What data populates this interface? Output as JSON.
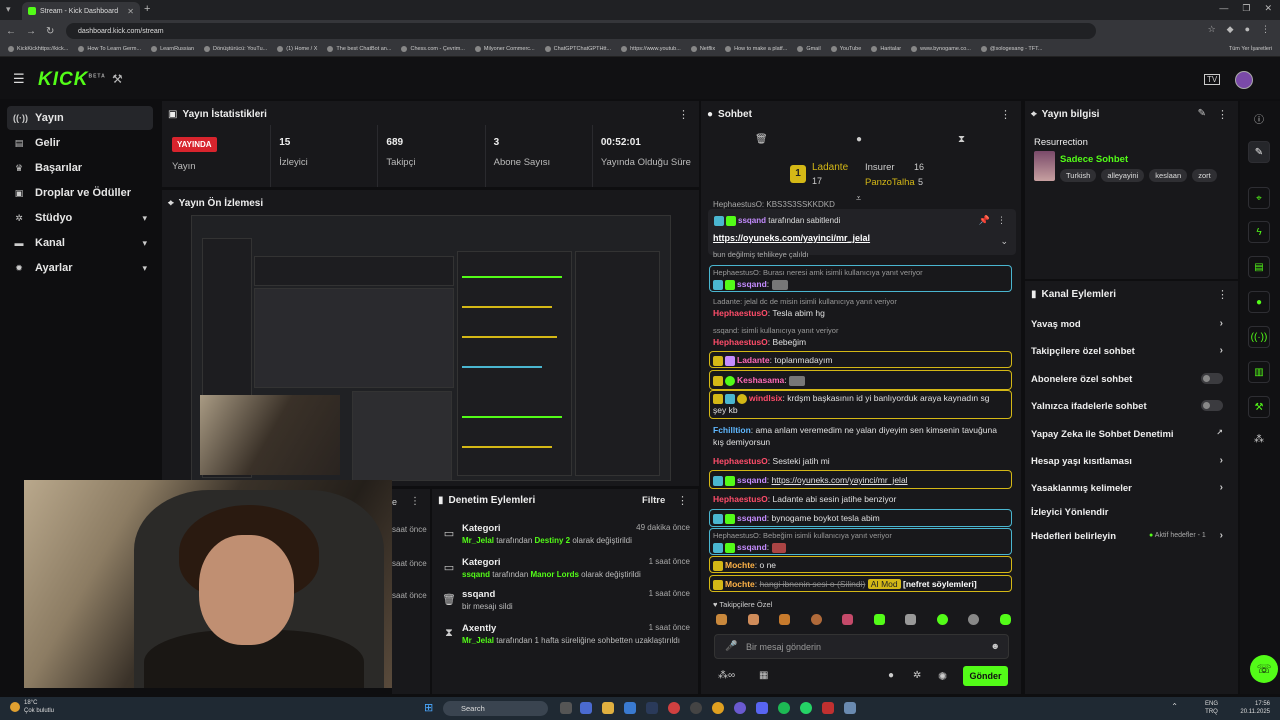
{
  "browser": {
    "tab_title": "Stream - Kick Dashboard",
    "url": "dashboard.kick.com/stream",
    "bookmarks": [
      "KickKickhttps://kick...",
      "How To Learn Germ...",
      "LearnRussian",
      "Dönüştürücü: YouTu...",
      "(1) Home / X",
      "The best ChatBot an...",
      "Chess.com - Çevrim...",
      "Milyoner Commerc...",
      "ChatGPTChatGPTHtt...",
      "https://www.youtub...",
      "Netflix",
      "How to make a platf...",
      "Gmail",
      "YouTube",
      "Haritalar",
      "www.bynogame.co...",
      "@sologesang - TFT..."
    ],
    "all_bookmarks": "Tüm Yer İşaretleri"
  },
  "header": {
    "logo": "KICK",
    "logo_sup": "BETA"
  },
  "sidebar": {
    "items": [
      {
        "label": "Yayın",
        "icon": "broadcast-icon"
      },
      {
        "label": "Gelir",
        "icon": "money-icon"
      },
      {
        "label": "Başarılar",
        "icon": "trophy-icon"
      },
      {
        "label": "Droplar ve Ödüller",
        "icon": "gift-icon"
      },
      {
        "label": "Stüdyo",
        "icon": "gear-icon"
      },
      {
        "label": "Kanal",
        "icon": "channel-icon"
      },
      {
        "label": "Ayarlar",
        "icon": "settings-icon"
      }
    ]
  },
  "stats": {
    "title": "Yayın İstatistikleri",
    "live_badge": "YAYINDA",
    "cells": [
      {
        "value": "",
        "label": "Yayın"
      },
      {
        "value": "15",
        "label": "İzleyici"
      },
      {
        "value": "689",
        "label": "Takipçi"
      },
      {
        "value": "3",
        "label": "Abone Sayısı"
      },
      {
        "value": "00:52:01",
        "label": "Yayında Olduğu Süre"
      }
    ]
  },
  "preview": {
    "title": "Yayın Ön İzlemesi"
  },
  "mod_actions": {
    "title": "Denetim Eylemleri",
    "filter": "Filtre",
    "left_times": [
      "saat önce",
      "saat önce",
      "saat önce"
    ],
    "items": [
      {
        "title": "Kategori",
        "user": "Mr_Jelal",
        "mid": " tarafından ",
        "target": "Destiny 2",
        "rest": " olarak değiştirildi",
        "time": "49 dakika önce"
      },
      {
        "title": "Kategori",
        "user": "ssqand",
        "mid": " tarafından ",
        "target": "Manor Lords",
        "rest": " olarak değiştirildi",
        "time": "1 saat önce"
      },
      {
        "title": "ssqand",
        "user": "",
        "mid": "",
        "target": "",
        "rest": "bir mesajı sildi",
        "time": "1 saat önce"
      },
      {
        "title": "Axently",
        "user": "Mr_Jelal",
        "mid": "",
        "target": "",
        "rest": " tarafından 1 hafta süreliğine sohbetten uzaklaştırıldı",
        "time": "1 saat önce"
      }
    ]
  },
  "chat": {
    "title": "Sohbet",
    "leaderboard": {
      "rank": "1",
      "first": {
        "name": "Ladante",
        "count": "17"
      },
      "second": {
        "name": "Insurer",
        "count": "16"
      },
      "third": {
        "name": "PanzoTalha",
        "count": "5"
      }
    },
    "pinned": {
      "by": "ssqand",
      "by_text": "tarafından sabitlendi",
      "link": "https://oyuneks.com/yayinci/mr_jelal"
    },
    "top_cut": "HephaestusO: KBS3S3SSKKDKD",
    "top_cut2": "bun değilmiş tehlikeye çalıldı",
    "messages": [
      {
        "reply": "HephaestusO: Burası neresi amk isimli kullanıcıya yanıt veriyor",
        "user": "ssqand",
        "text": ""
      },
      {
        "reply": "Ladante: jelal dc de misin isimli kullanıcıya yanıt veriyor",
        "user": "HephaestusO",
        "text": "Tesla abim hg"
      },
      {
        "reply": "ssqand: isimli kullanıcıya yanıt veriyor",
        "user": "HephaestusO",
        "text": "Bebeğim"
      },
      {
        "user": "Ladante",
        "text": "toplanmadayım"
      },
      {
        "user": "Keshasama",
        "text": ""
      },
      {
        "user": "windlsix",
        "text": "krdşm başkasının id yi banlıyorduk araya kaynadın sg",
        "text2": "şey kb"
      },
      {
        "user": "Fchilltion",
        "text": "ama anlam veremedim ne yalan diyeyim sen kimsenin tavuğuna",
        "text2": "kış demiyorsun"
      },
      {
        "user": "HephaestusO",
        "text": "Sesteki jatih mi"
      },
      {
        "user": "ssqand",
        "text": "https://oyuneks.com/yayinci/mr_jelal"
      },
      {
        "user": "HephaestusO",
        "text": "Ladante abi sesin jatihe benziyor"
      },
      {
        "user": "ssqand",
        "text": "bynogame boykot tesla abim"
      },
      {
        "reply": "HephaestusO: Bebeğim isimli kullanıcıya yanıt veriyor",
        "user": "ssqand",
        "text": ""
      },
      {
        "user": "Mochte",
        "text": "o ne"
      },
      {
        "user": "Mochte",
        "text": "hangi ibnenin sesi o (Silindi)",
        "ai": "AI Mod",
        "tag": "[nefret söylemleri]"
      }
    ],
    "followers_only": "Takipçilere Özel",
    "placeholder": "Bir mesaj gönderin",
    "send": "Gönder"
  },
  "stream_info": {
    "title": "Yayın bilgisi",
    "stream_title": "Resurrection",
    "category": "Sadece Sohbet",
    "tags": [
      "Turkish",
      "alleyayini",
      "keslaan",
      "zort"
    ]
  },
  "channel_actions": {
    "title": "Kanal Eylemleri",
    "items": [
      {
        "label": "Yavaş mod",
        "kind": "arrow"
      },
      {
        "label": "Takipçilere özel sohbet",
        "kind": "arrow"
      },
      {
        "label": "Abonelere özel sohbet",
        "kind": "toggle"
      },
      {
        "label": "Yalnızca ifadelerle sohbet",
        "kind": "toggle"
      },
      {
        "label": "Yapay Zeka ile Sohbet Denetimi",
        "kind": "ext"
      },
      {
        "label": "Hesap yaşı kısıtlaması",
        "kind": "arrow"
      },
      {
        "label": "Yasaklanmış kelimeler",
        "kind": "arrow"
      },
      {
        "label": "İzleyici Yönlendir",
        "kind": "none"
      },
      {
        "label": "Hedefleri belirleyin",
        "kind": "arrow",
        "status": "Aktif hedefler - 1"
      }
    ]
  },
  "taskbar": {
    "weather_temp": "18°C",
    "weather_desc": "Çok bulutlu",
    "search": "Search",
    "lang1": "ENG",
    "lang2": "TRQ",
    "time": "17:56",
    "date": "20.11.2025"
  },
  "colors": {
    "accent": "#53fc18",
    "live": "#d8242d",
    "panel": "#18181b"
  }
}
